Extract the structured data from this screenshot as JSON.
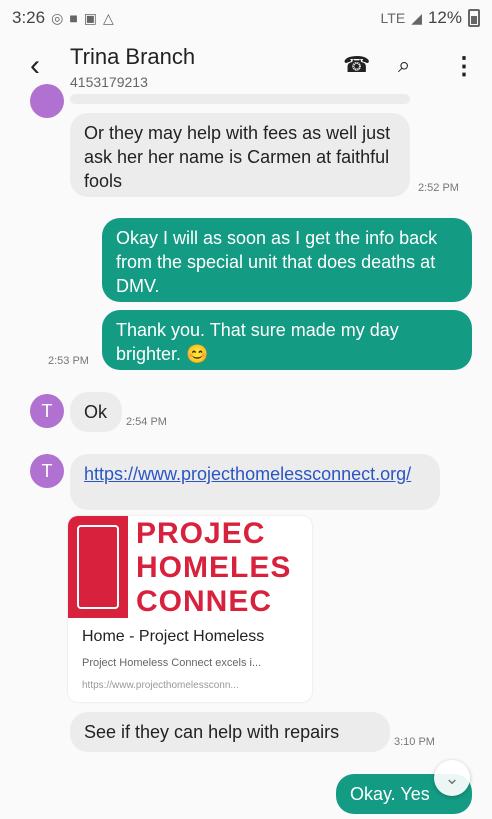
{
  "status_bar": {
    "time": "3:26",
    "network": "LTE",
    "battery": "12%",
    "icons": [
      "notification-icon",
      "lock-icon",
      "image-icon",
      "drive-icon"
    ]
  },
  "header": {
    "contact_name": "Trina Branch",
    "phone": "4153179213",
    "back": "‹",
    "call": "☎",
    "search": "⌕",
    "menu": "⋮"
  },
  "messages": [
    {
      "type": "in",
      "text": "Or they may help with fees as well just ask her her name is Carmen at faithful fools",
      "time": "2:52 PM"
    },
    {
      "type": "out",
      "text": "Okay I will as soon as I get the info back from the special unit that does deaths at DMV.",
      "time": ""
    },
    {
      "type": "out",
      "text": "Thank you.  That sure made my day brighter.  😊",
      "time": "2:53 PM"
    },
    {
      "type": "in",
      "text": "Ok",
      "time": "2:54 PM"
    },
    {
      "type": "in",
      "text": "https://www.projecthomelessconnect.org/",
      "time": ""
    },
    {
      "type": "in",
      "text": "See if they can help with repairs",
      "time": "3:10 PM"
    },
    {
      "type": "out",
      "text": "Okay.  Yes",
      "time": ""
    }
  ],
  "avatar_letter": "T",
  "link_preview": {
    "logo_lines": [
      "PROJEC",
      "HOMELES",
      "CONNEC"
    ],
    "title": "Home - Project Homeless",
    "description": "Project Homeless Connect excels i...",
    "url": "https://www.projecthomelessconn..."
  },
  "colors": {
    "outgoing": "#149b84",
    "incoming": "#ececec",
    "avatar": "#b071d1",
    "link": "#2b55c3"
  }
}
